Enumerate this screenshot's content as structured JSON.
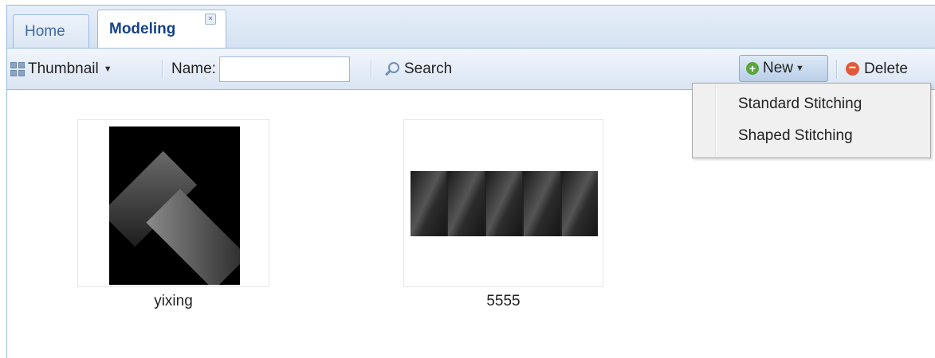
{
  "tabs": [
    {
      "label": "Home",
      "active": false
    },
    {
      "label": "Modeling",
      "active": true,
      "close_icon": "close-icon"
    }
  ],
  "toolbar": {
    "view_mode": "Thumbnail",
    "name_label": "Name:",
    "name_value": "",
    "search_label": "Search",
    "new_label": "New",
    "delete_label": "Delete"
  },
  "new_menu": {
    "items": [
      "Standard Stitching",
      "Shaped Stitching"
    ]
  },
  "items": [
    {
      "name": "yixing"
    },
    {
      "name": "5555"
    }
  ],
  "colors": {
    "accent": "#15428b",
    "border": "#99bbe8",
    "new_icon": "#5aa53c",
    "delete_icon": "#e05a3a"
  }
}
